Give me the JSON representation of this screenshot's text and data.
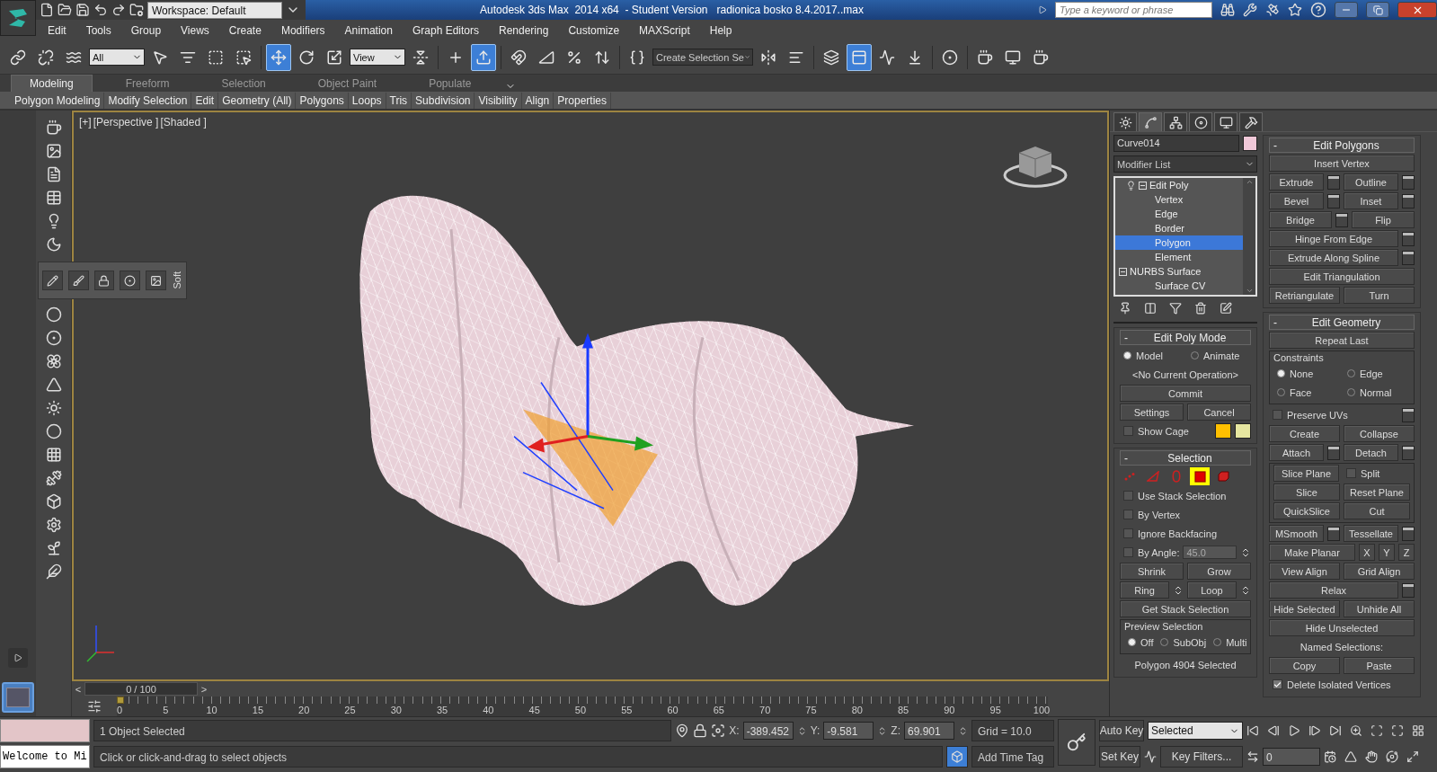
{
  "title_bar": {
    "workspace": "Workspace: Default",
    "title": "Autodesk 3ds Max  2014 x64  - Student Version   radionica bosko 8.4.2017..max",
    "search_placeholder": "Type a keyword or phrase"
  },
  "menu": [
    "Edit",
    "Tools",
    "Group",
    "Views",
    "Create",
    "Modifiers",
    "Animation",
    "Graph Editors",
    "Rendering",
    "Customize",
    "MAXScript",
    "Help"
  ],
  "main_toolbar": {
    "selection_filter": "All",
    "reference_coordinate_system": "View",
    "named_selection_set": "Create Selection Se",
    "tools": [
      {
        "selected": false
      },
      {
        "selected": false
      },
      {
        "selected": false
      },
      {
        "selected": false
      },
      {
        "selected": false
      },
      {
        "selected": false
      },
      {
        "selected": false
      },
      {
        "selected": true
      },
      {
        "selected": false
      },
      {
        "selected": false
      },
      {
        "selected": false
      },
      {
        "selected": false
      },
      {
        "selected": true
      },
      {
        "selected": false
      },
      {
        "selected": false
      },
      {
        "selected": false
      },
      {
        "selected": false
      },
      {
        "selected": false
      },
      {
        "selected": false
      },
      {
        "selected": false
      },
      {
        "selected": false
      },
      {
        "selected": true
      },
      {
        "selected": false
      },
      {
        "selected": false
      },
      {
        "selected": false
      },
      {
        "selected": false
      },
      {
        "selected": false
      },
      {
        "selected": false
      }
    ]
  },
  "ribbon": {
    "tabs": [
      {
        "label": "Modeling",
        "selected": true
      },
      {
        "label": "Freeform",
        "selected": false
      },
      {
        "label": "Selection",
        "selected": false
      },
      {
        "label": "Object Paint",
        "selected": false
      },
      {
        "label": "Populate",
        "selected": false
      }
    ],
    "panels": [
      "Polygon Modeling",
      "Modify Selection",
      "Edit",
      "Geometry (All)",
      "Polygons",
      "Loops",
      "Tris",
      "Subdivision",
      "Visibility",
      "Align",
      "Properties"
    ]
  },
  "floating_toolbar": {
    "label": "Soft"
  },
  "viewport": {
    "labels": [
      "[+]",
      "[Perspective ]",
      "[Shaded ]"
    ]
  },
  "time_slider": {
    "prev": "<",
    "label": "0 / 100",
    "next": ">"
  },
  "ruler_ticks": [
    "0",
    "5",
    "10",
    "15",
    "20",
    "25",
    "30",
    "35",
    "40",
    "45",
    "50",
    "55",
    "60",
    "65",
    "70",
    "75",
    "80",
    "85",
    "90",
    "95",
    "100"
  ],
  "command_panel": {
    "tabs": [
      {
        "selected": false
      },
      {
        "selected": true
      },
      {
        "selected": false
      },
      {
        "selected": false
      },
      {
        "selected": false
      },
      {
        "selected": false
      }
    ],
    "object_name": "Curve014",
    "modifier_list": "Modifier List",
    "stack": [
      {
        "label": "Edit Poly",
        "expanded": true,
        "selected": false,
        "children": [
          {
            "label": "Vertex",
            "selected": false
          },
          {
            "label": "Edge",
            "selected": false
          },
          {
            "label": "Border",
            "selected": false
          },
          {
            "label": "Polygon",
            "selected": true
          },
          {
            "label": "Element",
            "selected": false
          }
        ]
      },
      {
        "label": "NURBS Surface",
        "expanded": true,
        "selected": false,
        "children": [
          {
            "label": "Surface CV",
            "selected": false
          }
        ]
      }
    ],
    "left_rollouts": [
      {
        "toggle": "-",
        "title": "Edit Poly Mode",
        "rows": [
          [
            {
              "kind": "radio",
              "label": "Model",
              "selected": true
            },
            {
              "kind": "radio",
              "label": "Animate",
              "selected": false
            }
          ],
          [
            {
              "kind": "text",
              "label": "<No Current Operation>"
            }
          ],
          [
            {
              "kind": "button",
              "label": "Commit"
            }
          ],
          [
            {
              "kind": "button",
              "label": "Settings"
            },
            {
              "kind": "button",
              "label": "Cancel"
            }
          ],
          [
            {
              "kind": "check",
              "label": "Show Cage",
              "checked": false
            },
            {
              "kind": "swatch",
              "color": "#ffc000"
            },
            {
              "kind": "swatch",
              "color": "#e6e6a0"
            }
          ]
        ]
      },
      {
        "toggle": "-",
        "title": "Selection",
        "rows": [
          [
            {
              "kind": "level",
              "selected": false
            },
            {
              "kind": "level",
              "selected": false
            },
            {
              "kind": "level",
              "selected": false
            },
            {
              "kind": "level",
              "selected": true
            },
            {
              "kind": "level",
              "selected": false
            }
          ],
          [
            {
              "kind": "check",
              "label": "Use Stack Selection",
              "checked": false
            }
          ],
          [
            {
              "kind": "check",
              "label": "By Vertex",
              "checked": false
            }
          ],
          [
            {
              "kind": "check",
              "label": "Ignore Backfacing",
              "checked": false
            }
          ],
          [
            {
              "kind": "check",
              "label": "By Angle:",
              "checked": false
            },
            {
              "kind": "field",
              "value": "45.0"
            }
          ],
          [
            {
              "kind": "button",
              "label": "Shrink"
            },
            {
              "kind": "button",
              "label": "Grow"
            }
          ],
          [
            {
              "kind": "spinner",
              "label": "Ring"
            },
            {
              "kind": "spinner",
              "label": "Loop"
            }
          ],
          [
            {
              "kind": "button",
              "label": "Get Stack Selection"
            }
          ],
          [
            {
              "kind": "group",
              "title": "Preview Selection",
              "rows": [
                [
                  {
                    "kind": "radio",
                    "label": "Off",
                    "selected": true
                  },
                  {
                    "kind": "radio",
                    "label": "SubObj",
                    "selected": false
                  },
                  {
                    "kind": "radio",
                    "label": "Multi",
                    "selected": false
                  }
                ]
              ]
            }
          ],
          [
            {
              "kind": "text",
              "label": "Polygon 4904 Selected"
            }
          ]
        ]
      }
    ],
    "right_rollouts": [
      {
        "toggle": "-",
        "title": "Edit Polygons",
        "rows": [
          [
            {
              "kind": "button",
              "label": "Insert Vertex"
            }
          ],
          [
            {
              "kind": "button",
              "label": "Extrude"
            },
            {
              "kind": "settings"
            },
            {
              "kind": "button",
              "label": "Outline"
            },
            {
              "kind": "settings"
            }
          ],
          [
            {
              "kind": "button",
              "label": "Bevel"
            },
            {
              "kind": "settings"
            },
            {
              "kind": "button",
              "label": "Inset"
            },
            {
              "kind": "settings"
            }
          ],
          [
            {
              "kind": "button",
              "label": "Bridge"
            },
            {
              "kind": "settings"
            },
            {
              "kind": "button",
              "label": "Flip"
            }
          ],
          [
            {
              "kind": "button",
              "label": "Hinge From Edge"
            },
            {
              "kind": "settings"
            }
          ],
          [
            {
              "kind": "button",
              "label": "Extrude Along Spline"
            },
            {
              "kind": "settings"
            }
          ],
          [
            {
              "kind": "button",
              "label": "Edit Triangulation"
            }
          ],
          [
            {
              "kind": "button",
              "label": "Retriangulate"
            },
            {
              "kind": "button",
              "label": "Turn"
            }
          ]
        ]
      },
      {
        "toggle": "-",
        "title": "Edit Geometry",
        "rows": [
          [
            {
              "kind": "button",
              "label": "Repeat Last"
            }
          ],
          [
            {
              "kind": "group",
              "title": "Constraints",
              "rows": [
                [
                  {
                    "kind": "radio",
                    "label": "None",
                    "selected": true
                  },
                  {
                    "kind": "radio",
                    "label": "Edge",
                    "selected": false
                  }
                ],
                [
                  {
                    "kind": "radio",
                    "label": "Face",
                    "selected": false
                  },
                  {
                    "kind": "radio",
                    "label": "Normal",
                    "selected": false
                  }
                ]
              ]
            }
          ],
          [
            {
              "kind": "check",
              "label": "Preserve UVs",
              "checked": false
            },
            {
              "kind": "settings"
            }
          ],
          [
            {
              "kind": "button",
              "label": "Create"
            },
            {
              "kind": "button",
              "label": "Collapse"
            }
          ],
          [
            {
              "kind": "button",
              "label": "Attach"
            },
            {
              "kind": "settings"
            },
            {
              "kind": "button",
              "label": "Detach"
            },
            {
              "kind": "settings"
            }
          ],
          [
            {
              "kind": "group",
              "rows": [
                [
                  {
                    "kind": "button",
                    "label": "Slice Plane"
                  },
                  {
                    "kind": "check",
                    "label": "Split",
                    "checked": false
                  }
                ],
                [
                  {
                    "kind": "button",
                    "label": "Slice"
                  },
                  {
                    "kind": "button",
                    "label": "Reset Plane"
                  }
                ],
                [
                  {
                    "kind": "button",
                    "label": "QuickSlice"
                  },
                  {
                    "kind": "button",
                    "label": "Cut"
                  }
                ]
              ]
            }
          ],
          [
            {
              "kind": "button",
              "label": "MSmooth"
            },
            {
              "kind": "settings"
            },
            {
              "kind": "button",
              "label": "Tessellate"
            },
            {
              "kind": "settings"
            }
          ],
          [
            {
              "kind": "button",
              "label": "Make Planar"
            },
            {
              "kind": "axis",
              "label": "X"
            },
            {
              "kind": "axis",
              "label": "Y"
            },
            {
              "kind": "axis",
              "label": "Z"
            }
          ],
          [
            {
              "kind": "button",
              "label": "View Align"
            },
            {
              "kind": "button",
              "label": "Grid Align"
            }
          ],
          [
            {
              "kind": "button",
              "label": "Relax"
            },
            {
              "kind": "settings"
            }
          ],
          [
            {
              "kind": "button",
              "label": "Hide Selected"
            },
            {
              "kind": "button",
              "label": "Unhide All"
            }
          ],
          [
            {
              "kind": "button",
              "label": "Hide Unselected"
            }
          ],
          [
            {
              "kind": "text",
              "label": "Named Selections:"
            }
          ],
          [
            {
              "kind": "button",
              "label": "Copy"
            },
            {
              "kind": "button",
              "label": "Paste"
            }
          ],
          [
            {
              "kind": "check",
              "label": "Delete Isolated Vertices",
              "checked": true
            }
          ]
        ]
      }
    ]
  },
  "status_bar": {
    "listener_text": "Welcome to Mi",
    "selection_info": "1 Object Selected",
    "prompt": "Click or click-and-drag to select objects",
    "coords": [
      {
        "axis": "X:",
        "value": "-389.452"
      },
      {
        "axis": "Y:",
        "value": "-9.581"
      },
      {
        "axis": "Z:",
        "value": "69.901"
      }
    ],
    "grid": "Grid = 10.0",
    "time_tag": "Add Time Tag",
    "auto_key": "Auto Key",
    "set_key": "Set Key",
    "key_mode": "Selected",
    "key_filters": "Key Filters...",
    "current_frame": "0"
  }
}
